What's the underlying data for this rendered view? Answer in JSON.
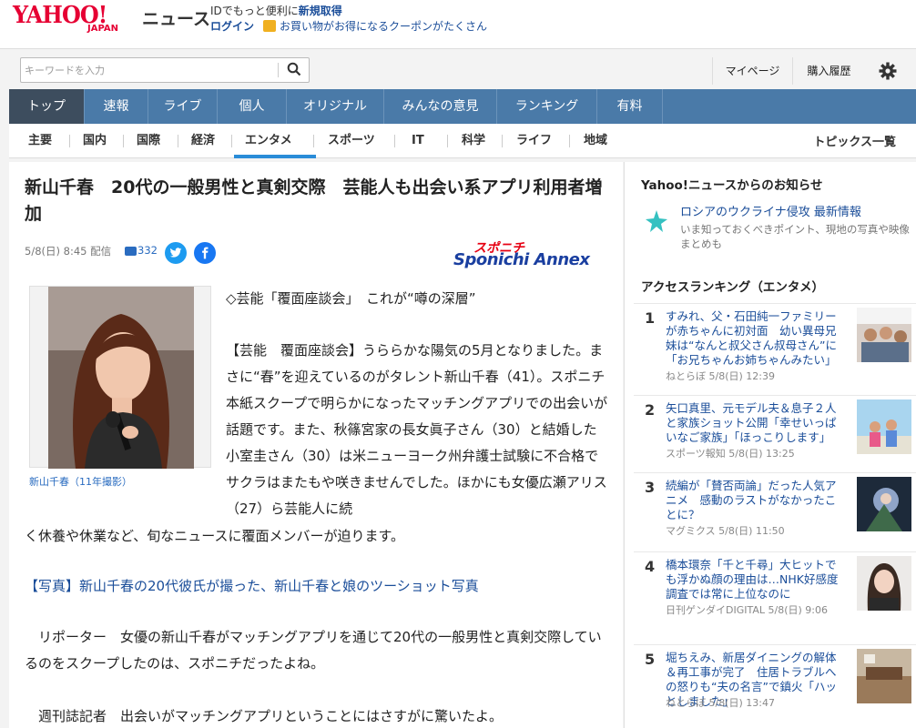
{
  "header": {
    "logo_yahoo": "YAHOO!",
    "logo_japan": "JAPAN",
    "logo_news": "ニュース",
    "promo_prefix": "IDでもっと便利に",
    "promo_link": "新規取得",
    "login": "ログイン",
    "coupon": "お買い物がお得になるクーポンがたくさん"
  },
  "search": {
    "placeholder": "キーワードを入力",
    "mypage": "マイページ",
    "history": "購入履歴"
  },
  "main_nav": [
    {
      "label": "トップ",
      "active": true
    },
    {
      "label": "速報"
    },
    {
      "label": "ライブ"
    },
    {
      "label": "個人"
    },
    {
      "label": "オリジナル"
    },
    {
      "label": "みんなの意見"
    },
    {
      "label": "ランキング"
    },
    {
      "label": "有料"
    }
  ],
  "sub_nav": [
    "主要",
    "国内",
    "国際",
    "経済",
    "エンタメ",
    "スポーツ",
    "IT",
    "科学",
    "ライフ",
    "地域"
  ],
  "sub_nav_topics": "トピックス一覧",
  "article": {
    "headline": "新山千春　20代の一般男性と真剣交際　芸能人も出会い系アプリ利用者増加",
    "date": "5/8(日) 8:45 配信",
    "comments": "332",
    "source_top": "スポニチ",
    "source_bottom": "Sponichi Annex",
    "caption": "新山千春（11年撮影）",
    "para1": "◇芸能「覆面座談会」　これが“噂の深層”",
    "para2": "【芸能　覆面座談会】うららかな陽気の5月となりました。まさに“春”を迎えているのがタレント新山千春（41）。スポニチ本紙スクープで明らかになったマッチングアプリでの出会いが話題です。また、秋篠宮家の長女眞子さん（30）と結婚した小室圭さん（30）は米ニューヨーク州弁護士試験に不合格でサクラはまたもや咲きませんでした。ほかにも女優広瀬アリス（27）ら芸能人に続",
    "para2b": "く休養や休業など、旬なニュースに覆面メンバーが迫ります。",
    "photo_link": "【写真】新山千春の20代彼氏が撮った、新山千春と娘のツーショット写真",
    "para3": "　リポーター　女優の新山千春がマッチングアプリを通じて20代の一般男性と真剣交際しているのをスクープしたのは、スポニチだったよね。",
    "para4": "　週刊誌記者　出会いがマッチングアプリということにはさすがに驚いたよ。"
  },
  "sidebar": {
    "notice_heading": "Yahoo!ニュースからのお知らせ",
    "notice_title": "ロシアのウクライナ侵攻 最新情報",
    "notice_desc": "いま知っておくべきポイント、現地の写真や映像まとめも",
    "ranking_heading": "アクセスランキング（エンタメ）",
    "ranking": [
      {
        "num": "1",
        "text": "すみれ、父・石田純一ファミリーが赤ちゃんに初対面　幼い異母兄妹は“なんと叔父さん叔母さん”に「お兄ちゃんお姉ちゃんみたい」",
        "source": "ねとらぼ 5/8(日) 12:39"
      },
      {
        "num": "2",
        "text": "矢口真里、元モデル夫＆息子２人と家族ショット公開「幸せいっぱいなご家族」「ほっこりします」",
        "source": "スポーツ報知 5/8(日) 13:25"
      },
      {
        "num": "3",
        "text": "続編が「賛否両論」だった人気アニメ　感動のラストがなかったことに？",
        "source": "マグミクス 5/8(日) 11:50"
      },
      {
        "num": "4",
        "text": "橋本環奈「千と千尋」大ヒットでも浮かぬ顔の理由は…NHK好感度調査では常に上位なのに",
        "source": "日刊ゲンダイDIGITAL 5/8(日) 9:06"
      },
      {
        "num": "5",
        "text": "堀ちえみ、新居ダイニングの解体＆再工事が完了　住居トラブルへの怒りも“夫の名言”で鎮火「ハッとしました」",
        "source": "ねとらぼ 5/8(日) 13:47"
      }
    ]
  }
}
